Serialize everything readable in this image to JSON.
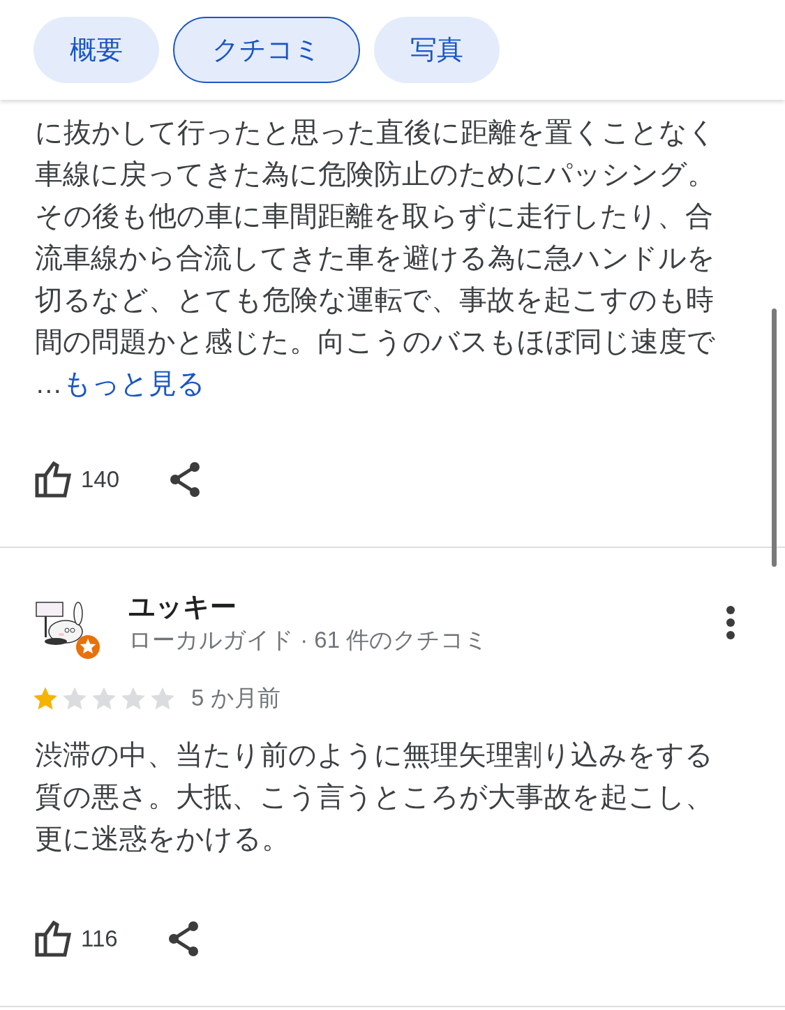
{
  "tabs": [
    {
      "label": "概要",
      "selected": false
    },
    {
      "label": "クチコミ",
      "selected": true
    },
    {
      "label": "写真",
      "selected": false
    }
  ],
  "reviews": [
    {
      "text_lines": [
        "に抜かして行ったと思った直後に距離を置くことなく",
        "車線に戻ってきた為に危険防止のためにパッシング。",
        "その後も他の車に車間距離を取らずに走行したり、合",
        "流車線から合流してきた車を避ける為に急ハンドルを",
        "切るなど、とても危険な運転で、事故を起こすのも時",
        "間の問題かと感じた。向こうのバスもほぼ同じ速度で"
      ],
      "ellipsis": "…",
      "more_link": "もっと見る",
      "likes": "140"
    },
    {
      "author": "ユッキー",
      "author_meta": "ローカルガイド · 61 件のクチコミ",
      "stars": 1,
      "time": "5 か月前",
      "text_lines": [
        "渋滞の中、当たり前のように無理矢理割り込みをする",
        "質の悪さ。大抵、こう言うところが大事故を起こし、",
        "更に迷惑をかける。"
      ],
      "likes": "116"
    }
  ]
}
